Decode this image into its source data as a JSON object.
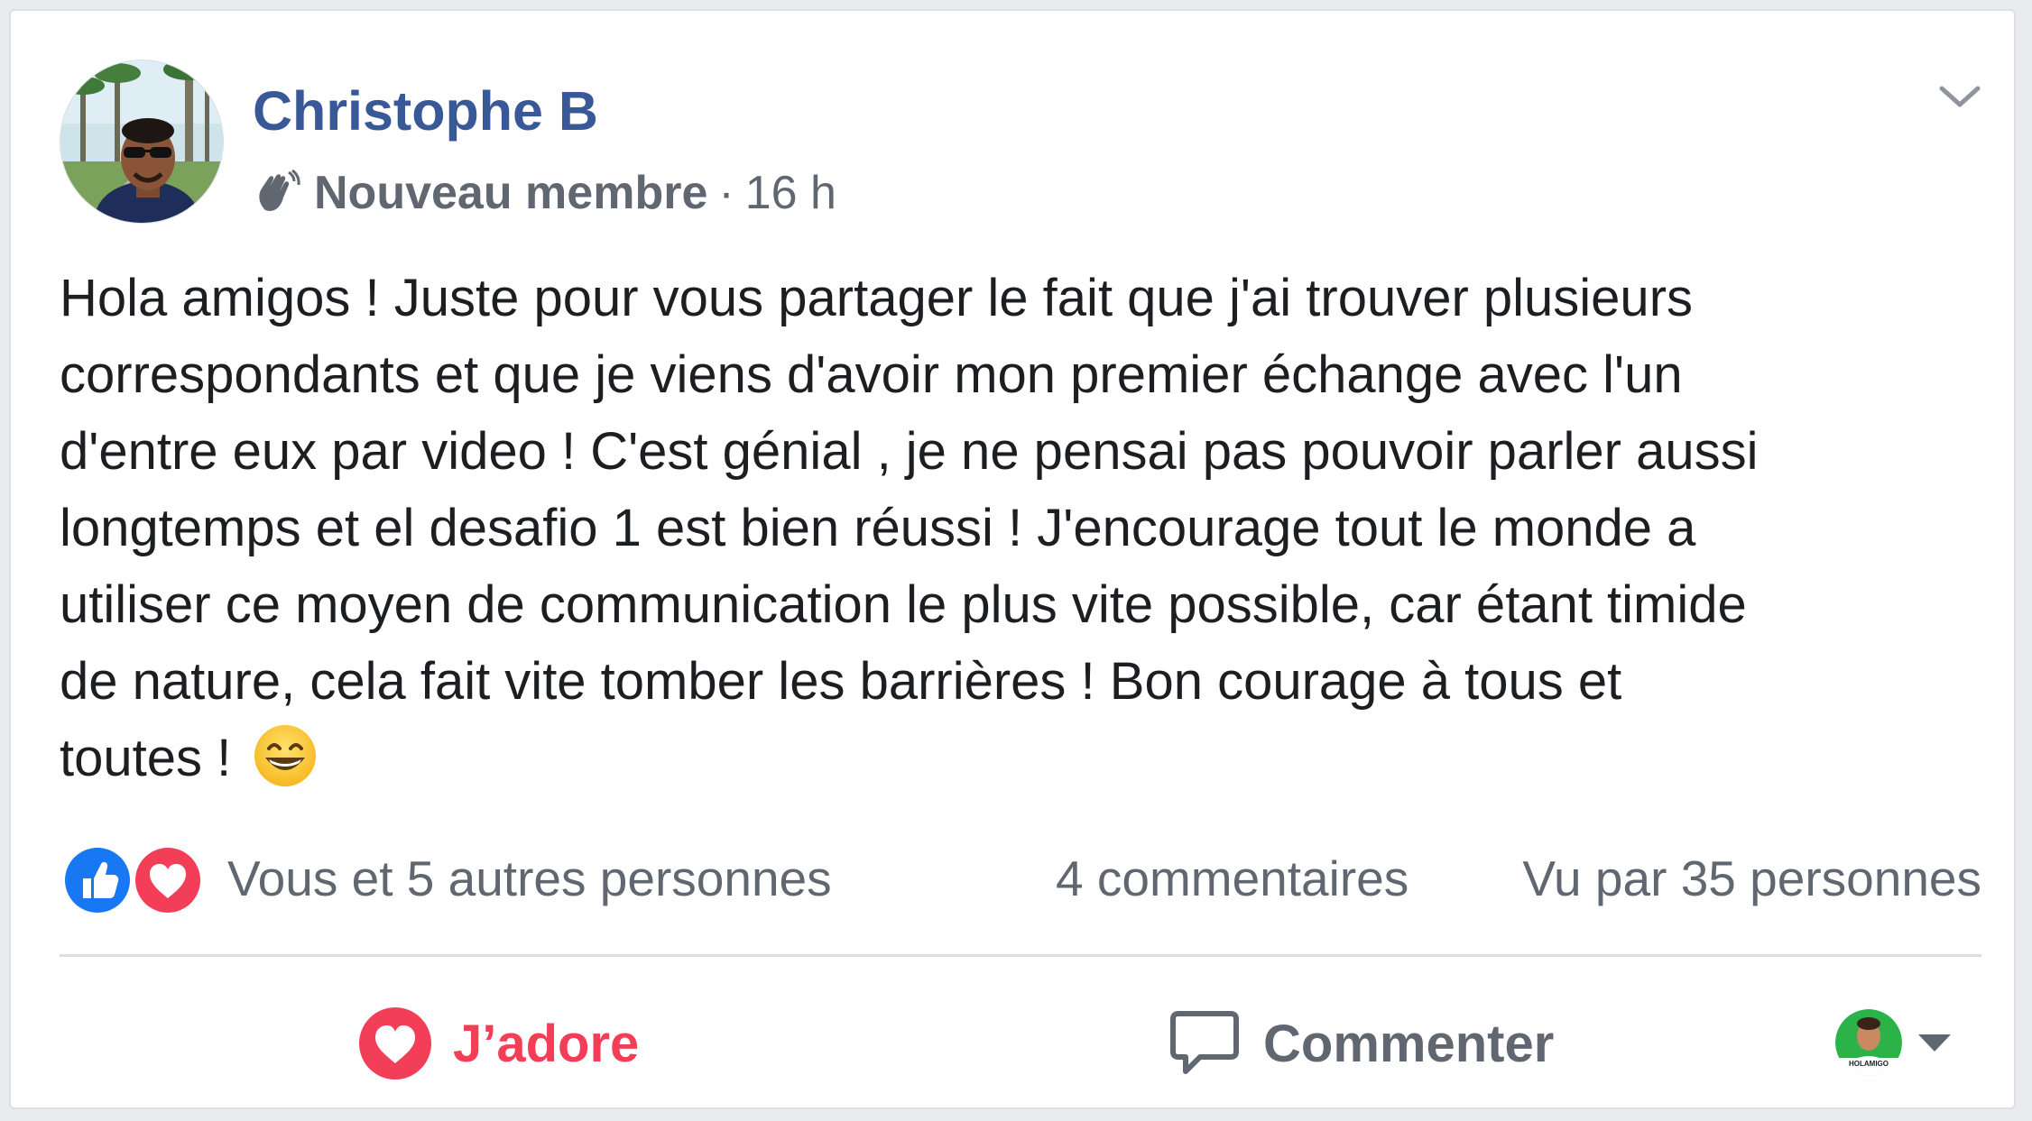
{
  "post": {
    "author": "Christophe B",
    "badge": "Nouveau membre",
    "separator": "·",
    "time": "16 h",
    "lines": [
      "Hola amigos ! Juste pour vous partager le fait que j'ai trouver plusieurs",
      "correspondants et que je viens d'avoir mon premier échange avec l'un",
      "d'entre eux par video ! C'est génial , je ne pensai pas pouvoir parler aussi",
      "longtemps et el desafio 1 est bien réussi ! J'encourage tout le monde a",
      "utiliser ce moyen de communication le plus vite possible, car étant timide",
      "de nature, cela fait vite tomber les barrières ! Bon courage à tous et",
      "toutes ! "
    ],
    "emoji": "grinning-face-with-smiling-eyes"
  },
  "stats": {
    "reactions": "Vous et 5 autres personnes",
    "comments": "4 commentaires",
    "seen": "Vu par 35 personnes"
  },
  "actions": {
    "love_label": "J’adore",
    "comment_label": "Commenter",
    "page_avatar_text": "HOLAMIGO"
  },
  "colors": {
    "author_blue": "#385898",
    "love_red": "#f33e58",
    "like_blue": "#1877f2",
    "secondary_text": "#606770",
    "page_green": "#2bb34a"
  },
  "icons": {
    "badge": "waving-hand-icon",
    "menu": "chevron-down-icon",
    "reaction_like": "like-reaction-icon",
    "reaction_love": "love-reaction-icon",
    "comment": "comment-bubble-icon",
    "caret": "caret-down-icon"
  }
}
